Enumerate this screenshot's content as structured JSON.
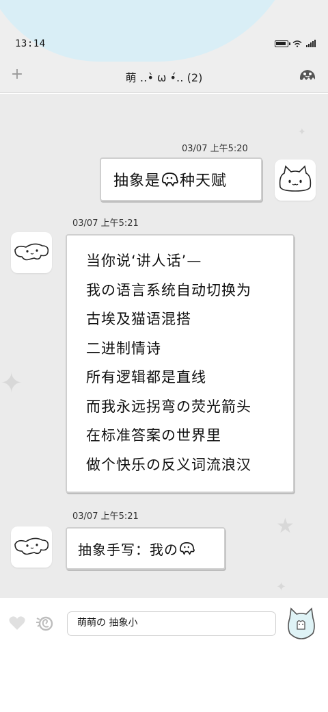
{
  "status_bar": {
    "time": "13:14",
    "icons": [
      "battery-icon",
      "wifi-icon",
      "signal-icon"
    ]
  },
  "header": {
    "title": "萌 ‥•̀ ω •́‥ (2)",
    "left_icon": "plus-icon",
    "right_icon": "ghost-menu-icon"
  },
  "messages": [
    {
      "timestamp": "03/07   上午5:20",
      "side": "right",
      "lines": [
        "抽象是",
        "种天赋"
      ]
    },
    {
      "timestamp": "03/07   上午5:21",
      "side": "left",
      "lines": [
        "当你说‘讲人话’—",
        "我の语言系统自动切换为",
        "古埃及猫语混搭",
        "二进制情诗",
        "所有逻辑都是直线",
        "而我永远拐弯の荧光箭头",
        "在标准答案の世界里",
        "做个快乐の反义词流浪汉"
      ]
    },
    {
      "timestamp": "03/07   上午5:21",
      "side": "left",
      "lines": [
        "抽象手写：我の"
      ]
    }
  ],
  "input_bar": {
    "value": "萌萌の 抽象小",
    "left_icons": [
      "heart-icon",
      "sticker-icon"
    ],
    "right_icon": "cat-voice-icon"
  },
  "colors": {
    "chat_bg": "#ebebeb",
    "top_cloud": "#d9eef6",
    "bubble_border": "#cfcfcf"
  }
}
